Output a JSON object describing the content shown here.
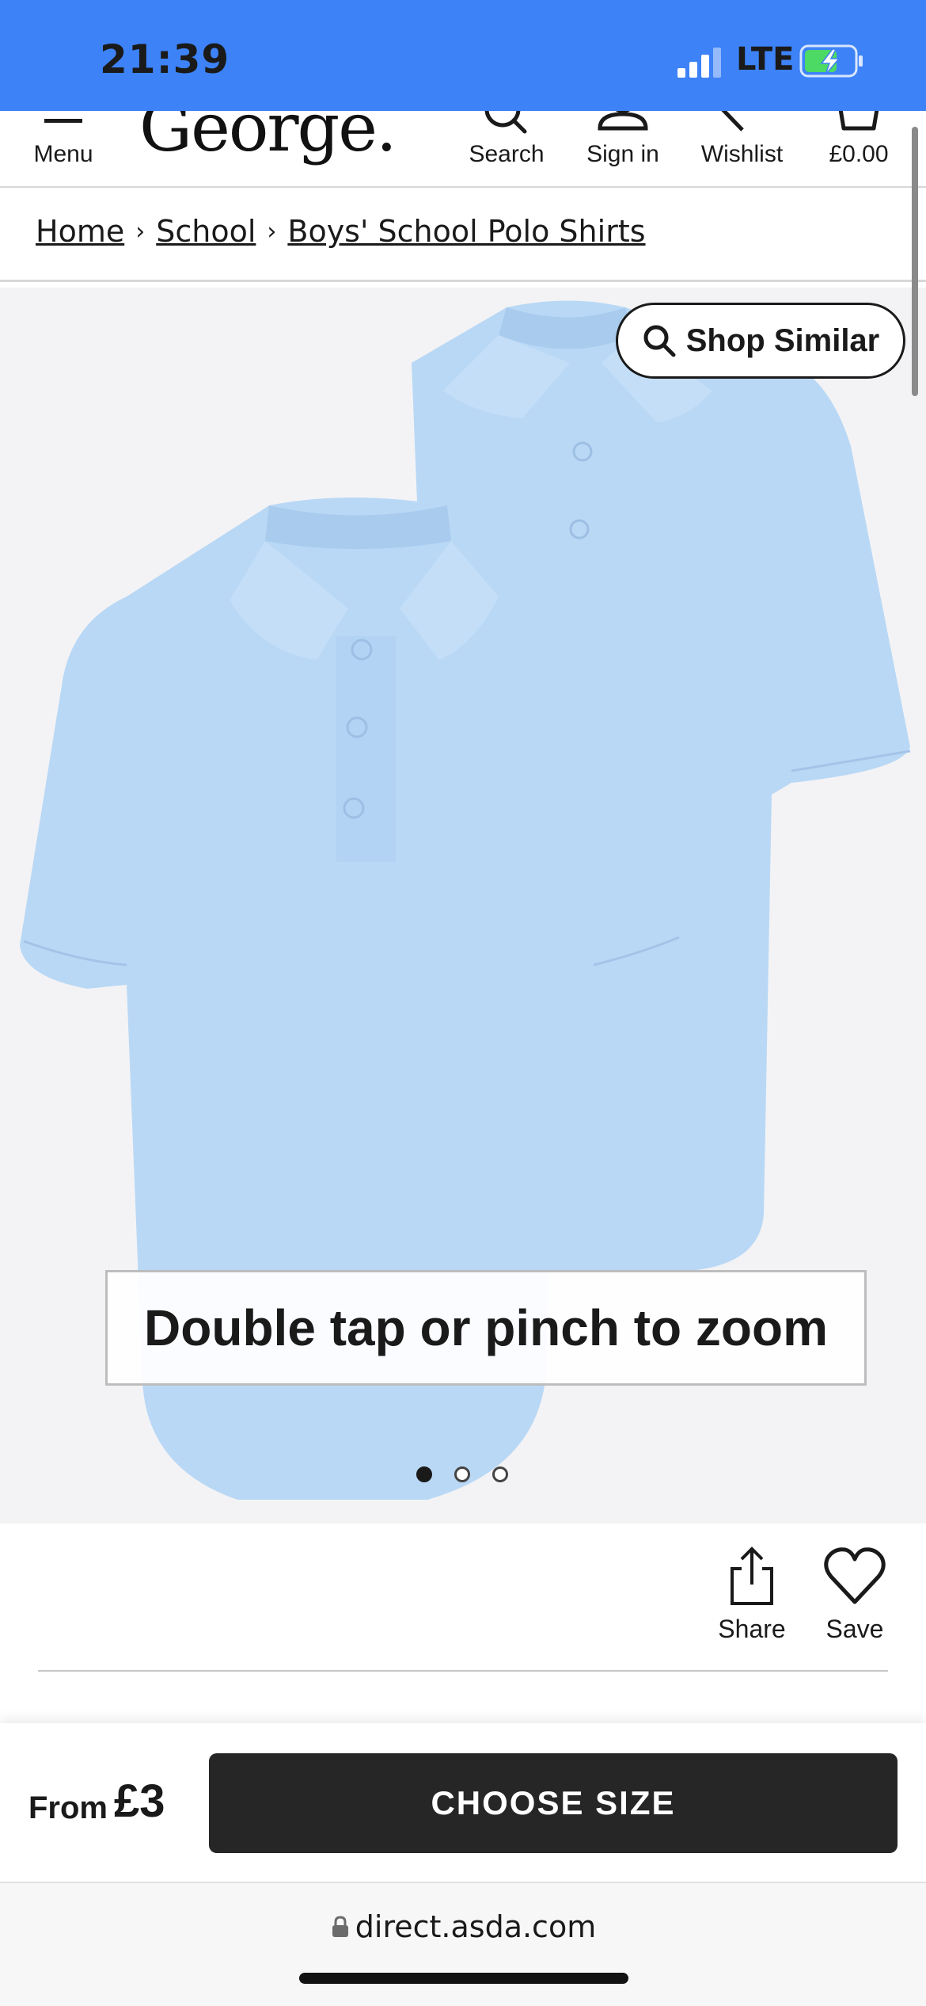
{
  "status_bar": {
    "time": "21:39",
    "network": "LTE"
  },
  "header": {
    "menu_label": "Menu",
    "logo": "George.",
    "search_label": "Search",
    "signin_label": "Sign in",
    "wishlist_label": "Wishlist",
    "basket_total": "£0.00"
  },
  "breadcrumb": {
    "items": [
      "Home",
      "School",
      "Boys' School Polo Shirts"
    ]
  },
  "gallery": {
    "shop_similar_label": "Shop Similar",
    "zoom_hint": "Double tap or pinch to zoom",
    "slide_count": 3,
    "active_slide": 1,
    "shirt_color": "#b9d8f5"
  },
  "actions": {
    "share_label": "Share",
    "save_label": "Save"
  },
  "purchase": {
    "from_label": "From",
    "price": "£3",
    "cta_label": "CHOOSE SIZE"
  },
  "browser": {
    "url": "direct.asda.com"
  },
  "colors": {
    "status_bar": "#3d82f7",
    "cta": "#262626",
    "battery": "#4cd964"
  }
}
